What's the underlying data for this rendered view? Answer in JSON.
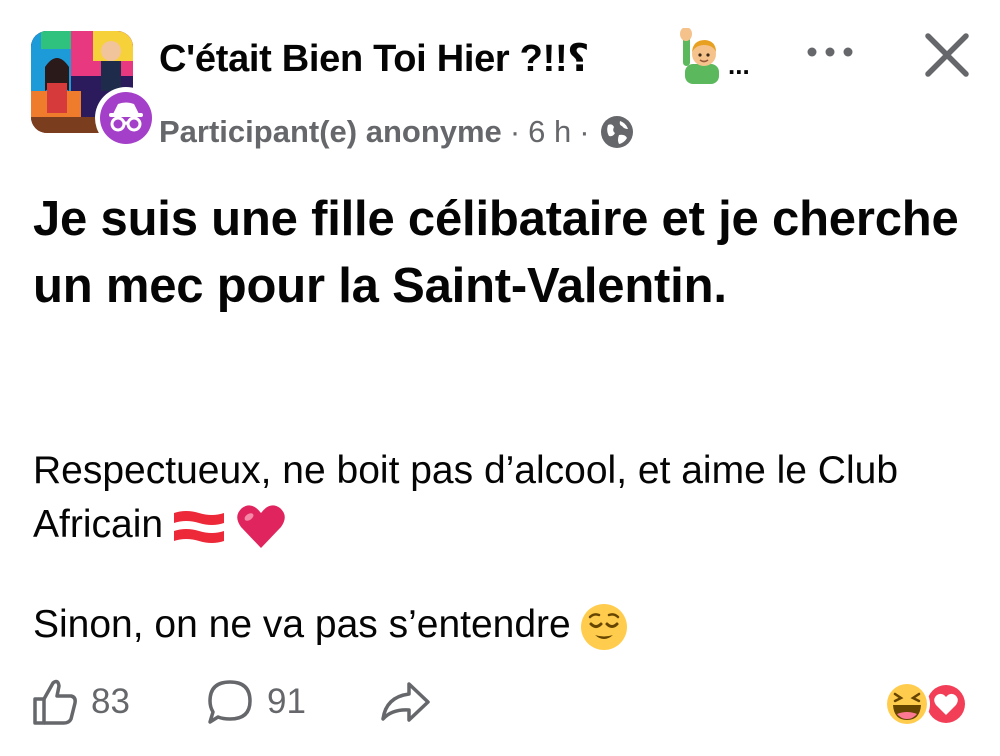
{
  "header": {
    "group_title": "C'était Bien Toi Hier ?!!؟",
    "title_emoji": "man-raising-hand-emoji",
    "title_truncation": "...",
    "author": "Participant(e) anonyme",
    "separator": "·",
    "time": "6 h",
    "privacy_icon": "globe-icon",
    "more_icon": "more-dots-icon",
    "close_icon": "close-icon",
    "anon_badge_icon": "incognito-icon"
  },
  "post": {
    "headline": "Je suis une fille célibataire et je cherche un mec pour la Saint-Valentin.",
    "paragraph1": "Respectueux, ne boit pas d’alcool, et aime le Club Africain",
    "paragraph1_emojis": [
      "red-white-flag-emoji",
      "red-heart-emoji"
    ],
    "paragraph2": "Sinon, on ne va pas s’entendre",
    "paragraph2_emoji": "relieved-face-emoji"
  },
  "footer": {
    "likes": "83",
    "comments": "91",
    "like_icon": "thumbs-up-icon",
    "comment_icon": "comment-bubble-icon",
    "share_icon": "share-arrow-icon",
    "reaction_icons": [
      "laughing-face-emoji",
      "love-heart-reaction-icon"
    ]
  },
  "colors": {
    "text_primary": "#050505",
    "text_secondary": "#65676b",
    "anon_purple": "#a43fc9",
    "heart_red": "#e0245e",
    "love_reaction": "#f33e58",
    "emoji_yellow": "#ffcc4d"
  }
}
